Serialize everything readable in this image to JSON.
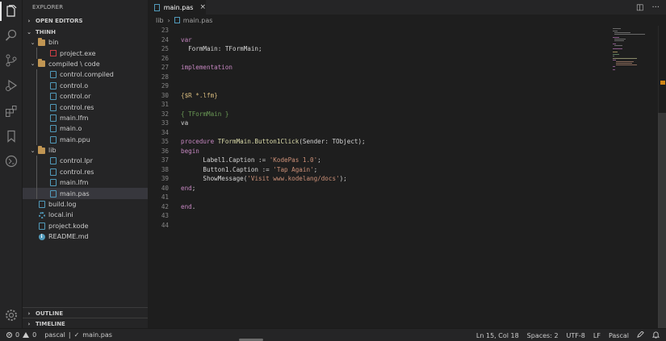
{
  "sidebar": {
    "title": "EXPLORER",
    "open_editors": "OPEN EDITORS",
    "workspace": "THINH",
    "tree": [
      {
        "label": "bin",
        "type": "folder",
        "depth": 1
      },
      {
        "label": "project.exe",
        "type": "exe",
        "depth": 2
      },
      {
        "label": "compiled \\ code",
        "type": "folder",
        "depth": 1
      },
      {
        "label": "control.compiled",
        "type": "doc",
        "depth": 2
      },
      {
        "label": "control.o",
        "type": "doc",
        "depth": 2
      },
      {
        "label": "control.or",
        "type": "doc",
        "depth": 2
      },
      {
        "label": "control.res",
        "type": "doc",
        "depth": 2
      },
      {
        "label": "main.lfm",
        "type": "doc",
        "depth": 2
      },
      {
        "label": "main.o",
        "type": "doc",
        "depth": 2
      },
      {
        "label": "main.ppu",
        "type": "doc",
        "depth": 2
      },
      {
        "label": "lib",
        "type": "folder",
        "depth": 1
      },
      {
        "label": "control.lpr",
        "type": "doc",
        "depth": 2
      },
      {
        "label": "control.res",
        "type": "doc",
        "depth": 2
      },
      {
        "label": "main.lfm",
        "type": "doc",
        "depth": 2
      },
      {
        "label": "main.pas",
        "type": "doc",
        "depth": 2,
        "selected": true
      },
      {
        "label": "build.log",
        "type": "doc",
        "depth": 1
      },
      {
        "label": "local.ini",
        "type": "gear",
        "depth": 1
      },
      {
        "label": "project.kode",
        "type": "doc",
        "depth": 1
      },
      {
        "label": "README.md",
        "type": "info",
        "depth": 1
      }
    ],
    "outline": "OUTLINE",
    "timeline": "TIMELINE"
  },
  "tab": {
    "label": "main.pas",
    "close": "×"
  },
  "tab_actions": {
    "split": "◫",
    "more": "···"
  },
  "breadcrumb": {
    "folder": "lib",
    "sep": "›",
    "file": "main.pas"
  },
  "editor": {
    "lines": [
      {
        "n": "23",
        "parts": []
      },
      {
        "n": "24",
        "parts": [
          {
            "c": "kw",
            "t": "var"
          }
        ]
      },
      {
        "n": "25",
        "parts": [
          {
            "c": "id",
            "t": "  FormMain: TFormMain;"
          }
        ]
      },
      {
        "n": "26",
        "parts": []
      },
      {
        "n": "27",
        "parts": [
          {
            "c": "kw",
            "t": "implementation"
          }
        ]
      },
      {
        "n": "28",
        "parts": []
      },
      {
        "n": "29",
        "parts": []
      },
      {
        "n": "30",
        "parts": [
          {
            "c": "dir",
            "t": "{$R *.lfm}"
          }
        ]
      },
      {
        "n": "31",
        "parts": []
      },
      {
        "n": "32",
        "parts": [
          {
            "c": "cmt",
            "t": "{ TFormMain }"
          }
        ]
      },
      {
        "n": "33",
        "parts": [
          {
            "c": "id",
            "t": "va"
          }
        ]
      },
      {
        "n": "34",
        "parts": []
      },
      {
        "n": "35",
        "parts": [
          {
            "c": "kw",
            "t": "procedure "
          },
          {
            "c": "fn",
            "t": "TFormMain.Button1Click"
          },
          {
            "c": "id",
            "t": "(Sender: TObject);"
          }
        ]
      },
      {
        "n": "36",
        "parts": [
          {
            "c": "kw",
            "t": "begin"
          }
        ]
      },
      {
        "n": "37",
        "parts": [
          {
            "c": "id",
            "t": "      Label1.Caption := "
          },
          {
            "c": "str",
            "t": "'KodePas 1.0'"
          },
          {
            "c": "id",
            "t": ";"
          }
        ]
      },
      {
        "n": "38",
        "parts": [
          {
            "c": "id",
            "t": "      Button1.Caption := "
          },
          {
            "c": "str",
            "t": "'Tap Again'"
          },
          {
            "c": "id",
            "t": ";"
          }
        ]
      },
      {
        "n": "39",
        "parts": [
          {
            "c": "id",
            "t": "      ShowMessage("
          },
          {
            "c": "str",
            "t": "'Visit www.kodelang/docs'"
          },
          {
            "c": "id",
            "t": ");"
          }
        ]
      },
      {
        "n": "40",
        "parts": [
          {
            "c": "kw",
            "t": "end"
          },
          {
            "c": "id",
            "t": ";"
          }
        ]
      },
      {
        "n": "41",
        "parts": []
      },
      {
        "n": "42",
        "parts": [
          {
            "c": "kw",
            "t": "end"
          },
          {
            "c": "id",
            "t": "."
          }
        ]
      },
      {
        "n": "43",
        "parts": []
      },
      {
        "n": "44",
        "parts": []
      }
    ]
  },
  "status": {
    "errors": "0",
    "warnings": "0",
    "language_left": "pascal",
    "pipe": "|",
    "check": "✓",
    "file": "main.pas",
    "position": "Ln 15, Col 18",
    "spaces": "Spaces: 2",
    "encoding": "UTF-8",
    "eol": "LF",
    "language": "Pascal"
  }
}
